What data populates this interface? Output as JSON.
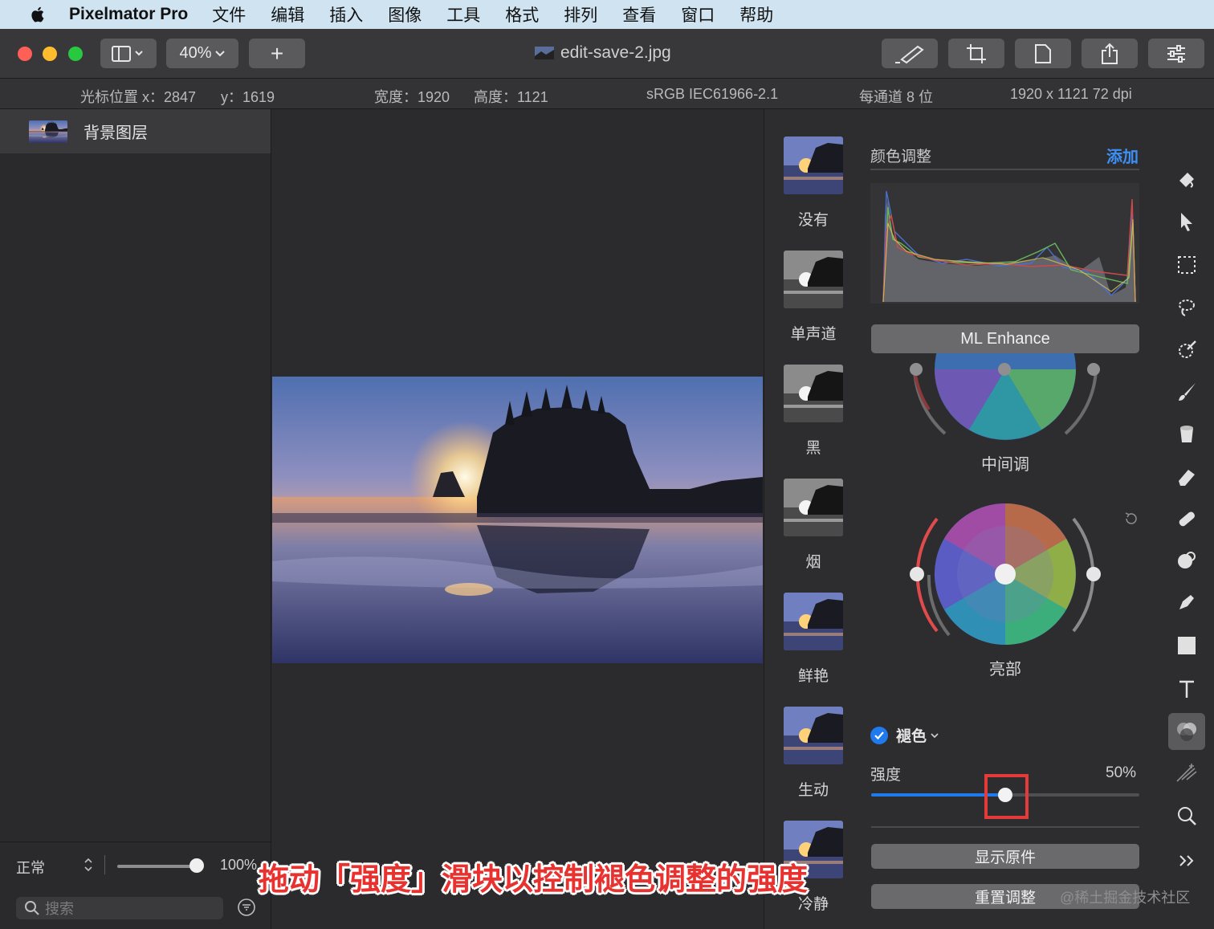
{
  "menubar": {
    "app_name": "Pixelmator Pro",
    "items": [
      "文件",
      "编辑",
      "插入",
      "图像",
      "工具",
      "格式",
      "排列",
      "查看",
      "窗口",
      "帮助"
    ]
  },
  "toolbar": {
    "zoom": "40%",
    "add_symbol": "+",
    "document_title": "edit-save-2.jpg"
  },
  "infobar": {
    "cursor_x": "光标位置 x：2847",
    "cursor_y": "y：1619",
    "width": "宽度：1920",
    "height": "高度：1121",
    "color_profile": "sRGB IEC61966-2.1",
    "bit_depth": "每通道 8 位",
    "dimensions": "1920 x 1121 72 dpi"
  },
  "layers": {
    "items": [
      {
        "name": "背景图层"
      }
    ],
    "blend_mode": "正常",
    "opacity": "100%",
    "opacity_level": 1.0,
    "search_placeholder": "搜索"
  },
  "presets": {
    "items": [
      {
        "label": "没有",
        "style": "color"
      },
      {
        "label": "单声道",
        "style": "mono"
      },
      {
        "label": "黑",
        "style": "mono"
      },
      {
        "label": "烟",
        "style": "mono"
      },
      {
        "label": "鲜艳",
        "style": "color"
      },
      {
        "label": "生动",
        "style": "color"
      },
      {
        "label": "冷静",
        "style": "color"
      }
    ]
  },
  "adjustments": {
    "title": "颜色调整",
    "add_label": "添加",
    "ml_enhance": "ML Enhance",
    "wheels": {
      "midtones": "中间调",
      "highlights": "亮部"
    },
    "fade": {
      "name": "褪色",
      "strength_label": "强度",
      "strength_value": "50%",
      "strength_level": 0.5
    },
    "show_original": "显示原件",
    "reset": "重置调整"
  },
  "colors": {
    "accent": "#1f7aee",
    "highlight_box": "#e53a3a",
    "caption": "#e8322f"
  },
  "tools": [
    "paint-bucket-icon",
    "arrow-icon",
    "rect-select-icon",
    "lasso-icon",
    "magic-wand-icon",
    "brush-icon",
    "fill-icon",
    "eraser-icon",
    "bandage-icon",
    "clone-icon",
    "pen-icon",
    "shape-icon",
    "text-icon",
    "color-adjust-icon",
    "effects-icon",
    "zoom-icon",
    "more-icon"
  ],
  "caption": "拖动「强度」滑块以控制褪色调整的强度",
  "watermark": "@稀土掘金技术社区"
}
